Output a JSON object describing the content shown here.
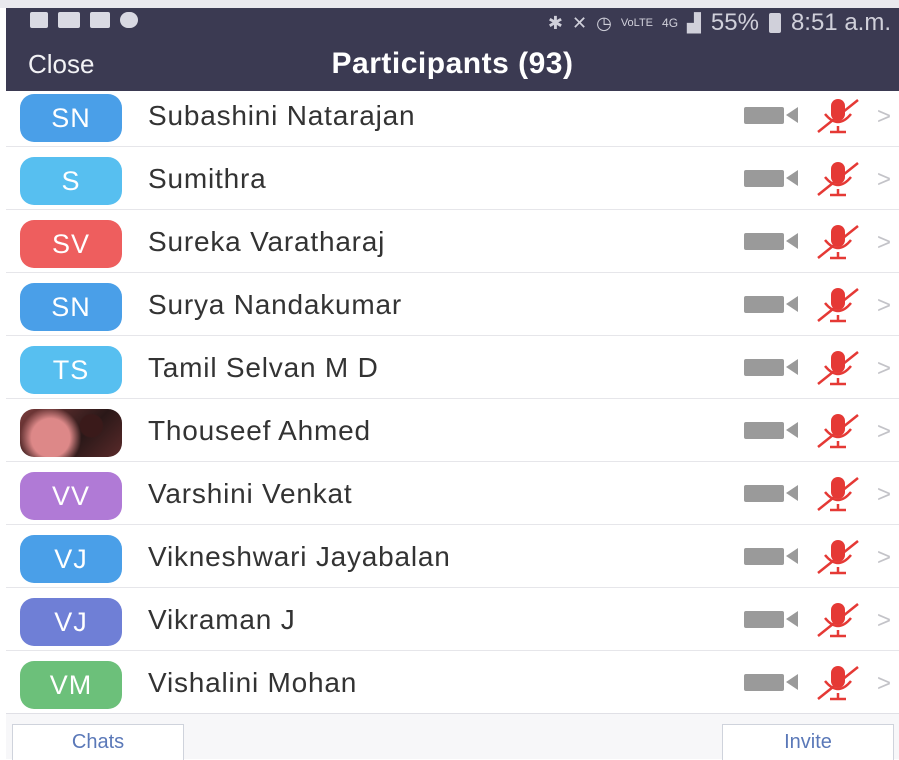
{
  "status_bar": {
    "battery": "55%",
    "time": "8:51 a.m.",
    "network": "4G",
    "left_icons": [
      "gallery-icon",
      "video-icon",
      "chat-icon",
      "whatsapp-icon"
    ],
    "right_icons": [
      "bluetooth-icon",
      "mute-icon",
      "alarm-icon",
      "volte-icon",
      "4g-icon",
      "signal-icon",
      "battery-icon"
    ]
  },
  "header": {
    "close_label": "Close",
    "title": "Participants (93)",
    "bg_color": "#3b3a52"
  },
  "participants": [
    {
      "initials": "SN",
      "name": "Subashini Natarajan",
      "avatar_color": "#4a9fe8"
    },
    {
      "initials": "S",
      "name": "Sumithra",
      "avatar_color": "#57bff0"
    },
    {
      "initials": "SV",
      "name": "Sureka Varatharaj",
      "avatar_color": "#ee5e5e"
    },
    {
      "initials": "SN",
      "name": "Surya Nandakumar",
      "avatar_color": "#4a9fe8"
    },
    {
      "initials": "TS",
      "name": "Tamil Selvan M D",
      "avatar_color": "#57bff0"
    },
    {
      "initials": "",
      "name": "Thouseef Ahmed",
      "avatar_color": "#5a2a2a",
      "photo": true
    },
    {
      "initials": "VV",
      "name": "Varshini Venkat",
      "avatar_color": "#b07ad6"
    },
    {
      "initials": "VJ",
      "name": "Vikneshwari Jayabalan",
      "avatar_color": "#4a9fe8"
    },
    {
      "initials": "VJ",
      "name": "Vikraman J",
      "avatar_color": "#6f7fd6"
    },
    {
      "initials": "VM",
      "name": "Vishalini Mohan",
      "avatar_color": "#6cc07a"
    }
  ],
  "participant_status": {
    "video": "off",
    "audio": "muted",
    "video_icon": "video-off-icon",
    "mic_icon": "mic-muted-icon",
    "chevron_icon": "chevron-right-icon"
  },
  "footer": {
    "chats_label": "Chats",
    "invite_label": "Invite"
  },
  "colors": {
    "mute_red": "#e53935",
    "cam_grey": "#9a9a9a",
    "link_blue": "#5a78b8"
  }
}
